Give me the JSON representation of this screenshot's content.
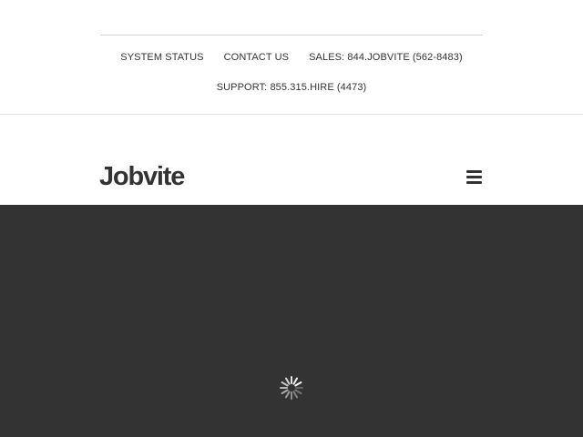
{
  "utility_nav": {
    "links": [
      {
        "label": "SYSTEM STATUS"
      },
      {
        "label": "CONTACT US"
      },
      {
        "label": "SALES: 844.JOBVITE (562-8483)"
      }
    ],
    "support": {
      "label": "SUPPORT: 855.315.HIRE (4473)"
    }
  },
  "header": {
    "logo_text": "Jobvite",
    "menu_icon": "hamburger-menu-icon"
  },
  "hero": {
    "background": "#333333",
    "loading_icon": "loading-spinner-icon"
  },
  "colors": {
    "text": "#333333",
    "hero_background": "#333333",
    "spinner": "#ffffff"
  }
}
